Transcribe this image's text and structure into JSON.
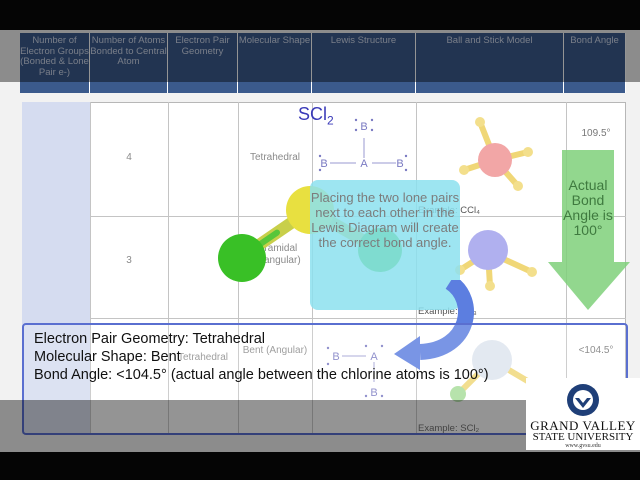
{
  "table": {
    "headers": [
      "Number of Electron Groups (Bonded & Lone Pair e-)",
      "Number of Atoms Bonded to Central Atom",
      "Electron Pair Geometry",
      "Molecular Shape",
      "Lewis Structure",
      "Ball and Stick Model",
      "Bond Angle"
    ],
    "rows": [
      {
        "atoms": "4",
        "geometry": "",
        "shape": "Tetrahedral",
        "angle": "109.5°",
        "example": "Example: CCl₄"
      },
      {
        "atoms": "3",
        "geometry": "",
        "shape": "Pyramidal (Triangular)",
        "angle": "",
        "example": "Example: NF₃"
      },
      {
        "atoms": "",
        "geometry": "Tetrahedral",
        "shape": "Bent (Angular)",
        "angle": "<104.5°",
        "example": "Example: SCl₂"
      }
    ],
    "formula": "SCl",
    "formula_sub": "2",
    "lewis_central": "A",
    "lewis_bonded": "B"
  },
  "callout": {
    "text": "Placing the two lone pairs next to each other in the Lewis Diagram will create the correct bond angle."
  },
  "arrow_label": {
    "text": "Actual Bond Angle is 100°"
  },
  "info": {
    "line1": "Electron  Pair Geometry: Tetrahedral",
    "line2": "Molecular Shape: Bent",
    "line3": "Bond Angle: <104.5° (actual angle between the chlorine atoms is 100°)"
  },
  "logo": {
    "line1": "GRAND VALLEY",
    "line2": "STATE UNIVERSITY",
    "url": "www.gvsu.edu"
  },
  "colors": {
    "header_bg": "#3b5a8c",
    "arrow_green": "#7fd07a",
    "callout_cyan": "#8ce1ee",
    "info_border": "#5a6fd0"
  }
}
